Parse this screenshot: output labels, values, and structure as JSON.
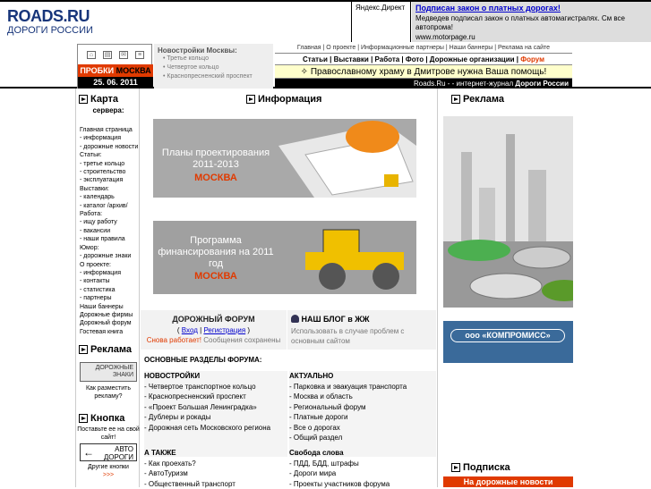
{
  "header": {
    "logo_title": "ROADS.RU",
    "logo_sub": "ДОРОГИ РОССИИ",
    "yandex_direct": "Яндекс.Директ",
    "ad_title": "Подписан закон о платных дорогах!",
    "ad_body": "Медведев подписал закон о платных автомагистралях. См все автопрома!",
    "ad_url": "www.motorpage.ru",
    "probki_prefix": "ПРОБКИ",
    "probki_city": "МОСКВА",
    "date": "25. 06. 2011",
    "novostroyki_title": "Новостройки Москвы:",
    "novostroyki_items": [
      "Третье кольцо",
      "Четвертое кольцо",
      "Краснопресненский проспект"
    ],
    "nav_small": "Главная | О проекте | Информационные партнеры | Наши баннеры | Реклама на сайте",
    "nav_main": "Статьи | Выставки | Работа | Фото | Дорожные организации |",
    "nav_forum": "Форум",
    "ticker": "Православному храму в Дмитрове нужна Ваша помощь!",
    "tagline_prefix": "Roads.Ru - - интернет-журнал",
    "tagline_bold": "Дороги России"
  },
  "left": {
    "map_title": "Карта",
    "map_sub": "сервера:",
    "map_items": [
      "Главная страница",
      "- информация",
      "- дорожные новости",
      "Статьи:",
      "- третье кольцо",
      "- строительство",
      "- эксплуатация",
      "Выставки:",
      "- календарь",
      "- каталог /архив/",
      "Работа:",
      "- ищу работу",
      "- вакансии",
      "- наши правила",
      "Юмор:",
      "- дорожные знаки",
      "О проекте:",
      "- информация",
      "- контакты",
      "- статистика",
      "- партнеры",
      "Наши баннеры",
      "Дорожные фирмы",
      "Дорожный форум",
      "Гостевая книга"
    ],
    "rek_title": "Реклама",
    "znaki_label": "ДОРОЖНЫЕ ЗНАКИ",
    "znaki_caption": "Как разместить рекламу?",
    "knopka_title": "Кнопка",
    "knopka_sub": "Поставьте ее на свой сайт!",
    "avto_label": "АВТО ДОРОГИ",
    "other_label": "Другие кнопки",
    "other_arrows": ">>>"
  },
  "center": {
    "info_title": "Информация",
    "banner1_text": "Планы проектирования 2011-2013",
    "banner1_city": "МОСКВА",
    "banner2_text": "Программа финансирования на 2011 год",
    "banner2_city": "МОСКВА",
    "forum_title": "ДОРОЖНЫЙ ФОРУМ",
    "forum_enter": "Вход",
    "forum_reg": "Регистрация",
    "forum_status": "Снова работает!",
    "forum_saved": "Сообщения сохранены",
    "blog_title": "НАШ БЛОГ в ЖЖ",
    "blog_text": "Использовать в случае проблем с основным сайтом",
    "sections_title": "ОСНОВНЫЕ РАЗДЕЛЫ ФОРУМА:",
    "s1_head": "НОВОСТРОЙКИ",
    "s1_items": [
      "- Четвертое транспортное кольцо",
      "- Краснопресненский проспект",
      "- «Проект Большая Ленинградка»",
      "- Дублеры и рокады",
      "- Дорожная сеть Московского региона"
    ],
    "s2_head": "АКТУАЛЬНО",
    "s2_items": [
      "- Парковка и эвакуация транспорта",
      "- Москва и область",
      "- Региональный форум",
      "- Платные дороги",
      "- Все о дорогах",
      "- Общий раздел"
    ],
    "s3_head": "А ТАКЖЕ",
    "s3_items": [
      "- Как проехать?",
      "- АвтоТуризм",
      "- Общественный транспорт"
    ],
    "s4_head": "Свобода слова",
    "s4_items": [
      "- ПДД, БДД, штрафы",
      "- Дороги мира",
      "- Проекты участников форума"
    ]
  },
  "right": {
    "rek_title": "Реклама",
    "komp_label": "ооо «КОМПРОМИСС»",
    "pod_title": "Подписка",
    "pod_bar": "На дорожные новости"
  }
}
